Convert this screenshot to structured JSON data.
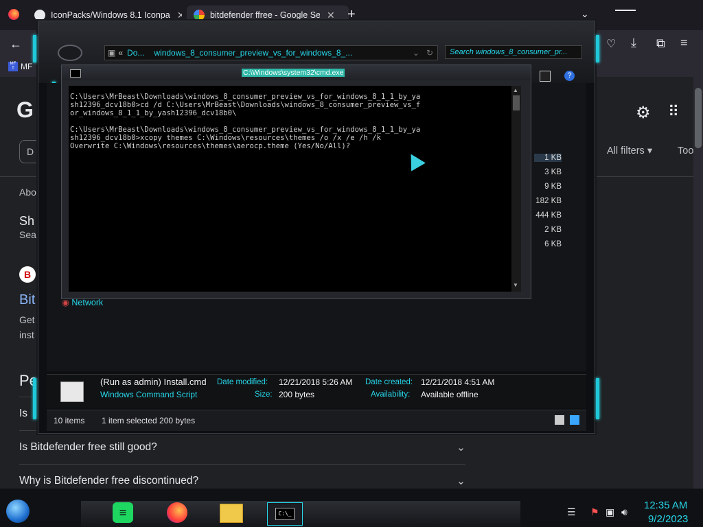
{
  "browser": {
    "tabs": [
      {
        "title": "IconPacks/Windows 8.1 Iconpa",
        "close": "✕"
      },
      {
        "title": "bitdefender ffree - Google Searc",
        "close": "✕"
      }
    ],
    "new_tab": "+",
    "bookmark_label": "MF",
    "bookmark_sub": "T"
  },
  "google": {
    "logo_partial": "G",
    "filter_chip": "D",
    "all_filters": "All filters",
    "tools": "Too",
    "about": "Abo",
    "result_title_partial": "Sh",
    "result_sub_partial": "Sea",
    "result_link_partial": "Bit",
    "result_snippet1": "Get",
    "result_snippet2": "inst",
    "people_also_partial": "Pe",
    "faq": [
      {
        "q": "Is"
      },
      {
        "q": "Is Bitdefender free still good?"
      },
      {
        "q": "Why is Bitdefender free discontinued?"
      }
    ]
  },
  "explorer": {
    "address_back": "«",
    "address_crumb1": "Do...",
    "address_crumb2": "windows_8_consumer_preview_vs_for_windows_8_...",
    "search_placeholder": "Search windows_8_consumer_pr...",
    "sizes": [
      "1 KB",
      "3 KB",
      "9 KB",
      "182 KB",
      "444 KB",
      "2 KB",
      "6 KB"
    ],
    "nav_network": "Network",
    "details": {
      "file_name": "(Run as admin) Install.cmd",
      "file_type": "Windows Command Script",
      "modified_label": "Date modified:",
      "modified_value": "12/21/2018 5:26 AM",
      "size_label": "Size:",
      "size_value": "200 bytes",
      "created_label": "Date created:",
      "created_value": "12/21/2018 4:51 AM",
      "availability_label": "Availability:",
      "availability_value": "Available offline"
    },
    "status": {
      "items": "10 items",
      "selected": "1 item selected  200 bytes"
    }
  },
  "cmd": {
    "title": "C:\\Windows\\system32\\cmd.exe",
    "lines": "C:\\Users\\MrBeast\\Downloads\\windows_8_consumer_preview_vs_for_windows_8_1_1_by_ya\nsh12396_dcv18b0>cd /d C:\\Users\\MrBeast\\Downloads\\windows_8_consumer_preview_vs_f\nor_windows_8_1_1_by_yash12396_dcv18b0\\\n\nC:\\Users\\MrBeast\\Downloads\\windows_8_consumer_preview_vs_for_windows_8_1_1_by_ya\nsh12396_dcv18b0>xcopy themes C:\\Windows\\resources\\themes /o /x /e /h /k\nOverwrite C:\\Windows\\resources\\themes\\aerocp.theme (Yes/No/All)?"
  },
  "taskbar": {
    "time": "12:35 AM",
    "date": "9/2/2023",
    "cmd_icon_text": "C:\\_"
  },
  "colors": {
    "accent": "#1fc8d8",
    "browser_bg": "#2b2a33",
    "page_bg": "#202124"
  }
}
